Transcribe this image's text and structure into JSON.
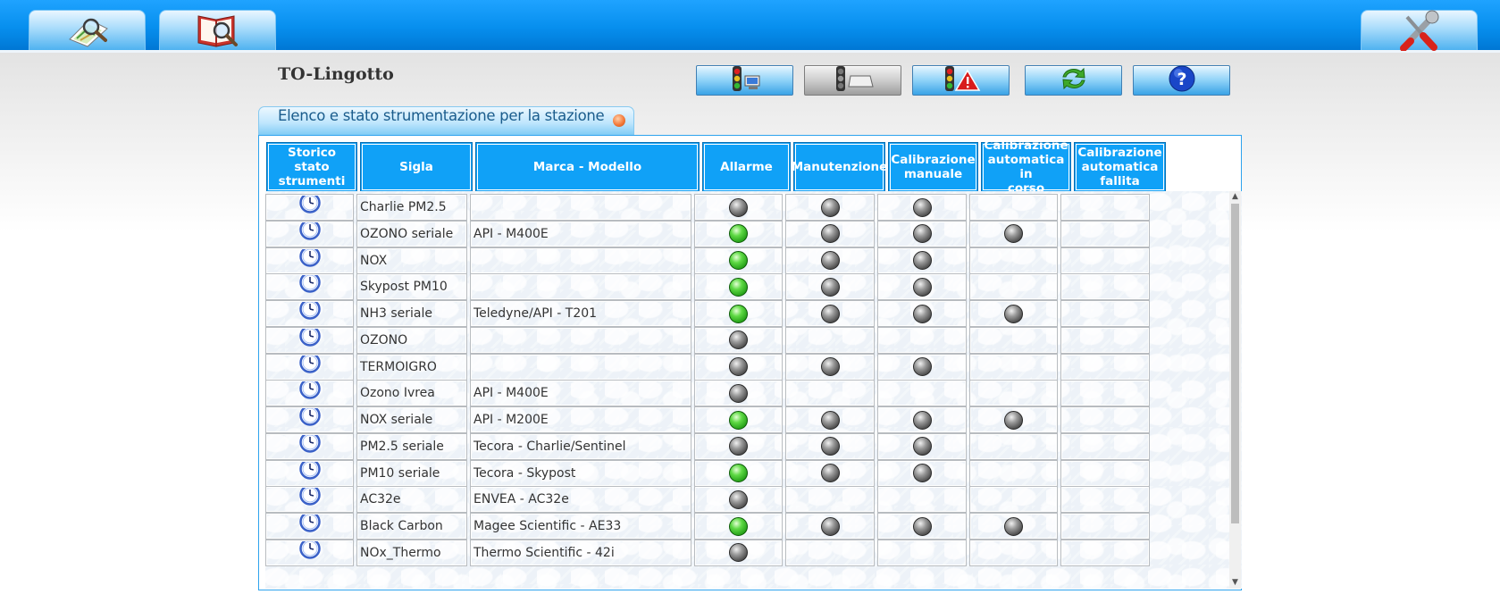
{
  "topbar": {
    "tabs": [
      {
        "icon": "search-map-icon"
      },
      {
        "icon": "search-book-icon"
      },
      {
        "icon": "tools-icon"
      }
    ]
  },
  "station": {
    "title": "TO-Lingotto"
  },
  "toolbar": {
    "buttons": [
      {
        "icon": "traffic-light-computer-icon"
      },
      {
        "icon": "traffic-light-device-icon"
      },
      {
        "icon": "traffic-light-warning-icon"
      },
      {
        "icon": "refresh-icon"
      },
      {
        "icon": "help-icon"
      }
    ]
  },
  "panel": {
    "title": "Elenco e stato strumentazione per la stazione"
  },
  "table": {
    "headers": [
      {
        "l1": "Storico stato",
        "l2": "strumenti",
        "l3": ""
      },
      {
        "l1": "Sigla",
        "l2": "",
        "l3": ""
      },
      {
        "l1": "Marca - Modello",
        "l2": "",
        "l3": ""
      },
      {
        "l1": "Allarme",
        "l2": "",
        "l3": ""
      },
      {
        "l1": "Manutenzione",
        "l2": "",
        "l3": ""
      },
      {
        "l1": "Calibrazione",
        "l2": "manuale",
        "l3": ""
      },
      {
        "l1": "Calibrazione",
        "l2": "automatica in",
        "l3": "corso"
      },
      {
        "l1": "Calibrazione",
        "l2": "automatica",
        "l3": "fallita"
      }
    ],
    "rows": [
      {
        "sigla": "Charlie PM2.5",
        "modello": "",
        "allarme": "gray",
        "manutenzione": "gray",
        "cal_manuale": "gray",
        "cal_auto_corso": "",
        "cal_auto_fallita": ""
      },
      {
        "sigla": "OZONO seriale",
        "modello": "API - M400E",
        "allarme": "green",
        "manutenzione": "gray",
        "cal_manuale": "gray",
        "cal_auto_corso": "gray",
        "cal_auto_fallita": ""
      },
      {
        "sigla": "NOX",
        "modello": "",
        "allarme": "green",
        "manutenzione": "gray",
        "cal_manuale": "gray",
        "cal_auto_corso": "",
        "cal_auto_fallita": ""
      },
      {
        "sigla": "Skypost PM10",
        "modello": "",
        "allarme": "green",
        "manutenzione": "gray",
        "cal_manuale": "gray",
        "cal_auto_corso": "",
        "cal_auto_fallita": ""
      },
      {
        "sigla": "NH3 seriale",
        "modello": "Teledyne/API - T201",
        "allarme": "green",
        "manutenzione": "gray",
        "cal_manuale": "gray",
        "cal_auto_corso": "gray",
        "cal_auto_fallita": ""
      },
      {
        "sigla": "OZONO",
        "modello": "",
        "allarme": "gray",
        "manutenzione": "",
        "cal_manuale": "",
        "cal_auto_corso": "",
        "cal_auto_fallita": ""
      },
      {
        "sigla": "TERMOIGRO",
        "modello": "",
        "allarme": "gray",
        "manutenzione": "gray",
        "cal_manuale": "gray",
        "cal_auto_corso": "",
        "cal_auto_fallita": ""
      },
      {
        "sigla": "Ozono Ivrea",
        "modello": "API - M400E",
        "allarme": "gray",
        "manutenzione": "",
        "cal_manuale": "",
        "cal_auto_corso": "",
        "cal_auto_fallita": ""
      },
      {
        "sigla": "NOX seriale",
        "modello": "API - M200E",
        "allarme": "green",
        "manutenzione": "gray",
        "cal_manuale": "gray",
        "cal_auto_corso": "gray",
        "cal_auto_fallita": ""
      },
      {
        "sigla": "PM2.5 seriale",
        "modello": "Tecora - Charlie/Sentinel",
        "allarme": "gray",
        "manutenzione": "gray",
        "cal_manuale": "gray",
        "cal_auto_corso": "",
        "cal_auto_fallita": ""
      },
      {
        "sigla": "PM10 seriale",
        "modello": "Tecora - Skypost",
        "allarme": "green",
        "manutenzione": "gray",
        "cal_manuale": "gray",
        "cal_auto_corso": "",
        "cal_auto_fallita": ""
      },
      {
        "sigla": "AC32e",
        "modello": "ENVEA - AC32e",
        "allarme": "gray",
        "manutenzione": "",
        "cal_manuale": "",
        "cal_auto_corso": "",
        "cal_auto_fallita": ""
      },
      {
        "sigla": "Black Carbon",
        "modello": "Magee Scientific - AE33",
        "allarme": "green",
        "manutenzione": "gray",
        "cal_manuale": "gray",
        "cal_auto_corso": "gray",
        "cal_auto_fallita": ""
      },
      {
        "sigla": "NOx_Thermo",
        "modello": "Thermo Scientific - 42i",
        "allarme": "gray",
        "manutenzione": "",
        "cal_manuale": "",
        "cal_auto_corso": "",
        "cal_auto_fallita": ""
      }
    ]
  },
  "scrollbar": {
    "up_glyph": "▲",
    "down_glyph": "▼"
  }
}
